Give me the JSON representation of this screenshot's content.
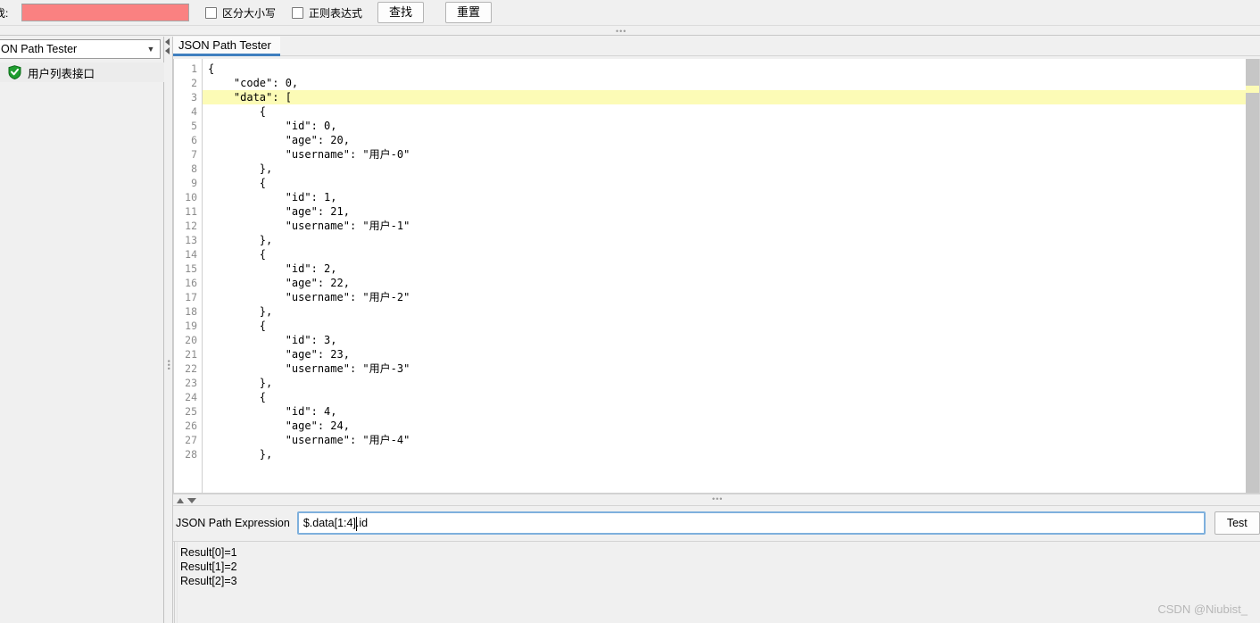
{
  "toolbar": {
    "find_label": "找:",
    "search_value": "",
    "search_placeholder": "",
    "search_fill_color": "#fa8181",
    "checkbox_case_sensitive": "区分大小写",
    "checkbox_regex": "正则表达式",
    "find_button": "查找",
    "reset_button": "重置",
    "splitter_dots": "•••"
  },
  "sidebar": {
    "combo_value": "ON Path Tester",
    "combo_arrow": "▼",
    "tree_items": [
      {
        "label": "用户列表接口",
        "icon": "shield-check-icon"
      }
    ],
    "splitter_dots": "•••"
  },
  "tabs": [
    {
      "label": "JSON Path Tester",
      "active": true,
      "accent_color": "#3f7fbf"
    }
  ],
  "editor": {
    "highlight_color": "#fcfbb6",
    "highlighted_line": 3,
    "line_numbers": [
      1,
      2,
      3,
      4,
      5,
      6,
      7,
      8,
      9,
      10,
      11,
      12,
      13,
      14,
      15,
      16,
      17,
      18,
      19,
      20,
      21,
      22,
      23,
      24,
      25,
      26,
      27,
      28
    ],
    "lines": [
      "{",
      "    \"code\": 0,",
      "    \"data\": [",
      "        {",
      "            \"id\": 0,",
      "            \"age\": 20,",
      "            \"username\": \"用户-0\"",
      "        },",
      "        {",
      "            \"id\": 1,",
      "            \"age\": 21,",
      "            \"username\": \"用户-1\"",
      "        },",
      "        {",
      "            \"id\": 2,",
      "            \"age\": 22,",
      "            \"username\": \"用户-2\"",
      "        },",
      "        {",
      "            \"id\": 3,",
      "            \"age\": 23,",
      "            \"username\": \"用户-3\"",
      "        },",
      "        {",
      "            \"id\": 4,",
      "            \"age\": 24,",
      "            \"username\": \"用户-4\"",
      "        },"
    ]
  },
  "bottom_splitter": {
    "dots": "•••"
  },
  "expression": {
    "label": "JSON Path Expression",
    "value": "$.data[1:4].id",
    "placeholder": "",
    "test_button": "Test"
  },
  "results": {
    "lines": [
      "Result[0]=1",
      "Result[1]=2",
      "Result[2]=3"
    ]
  },
  "watermark": "CSDN @Niubist_"
}
